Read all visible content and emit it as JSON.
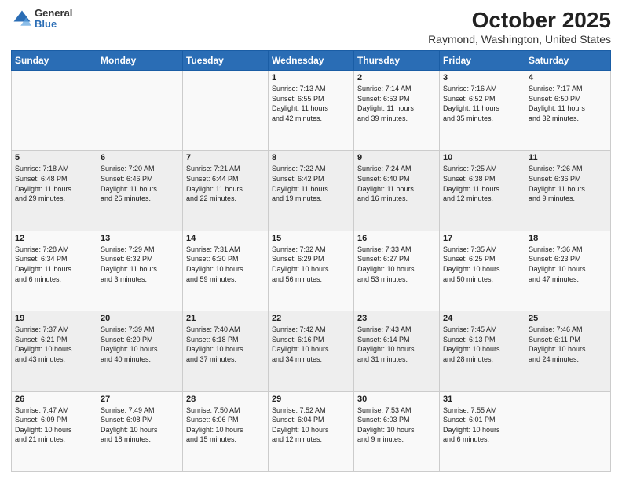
{
  "header": {
    "logo": {
      "general": "General",
      "blue": "Blue"
    },
    "title": "October 2025",
    "subtitle": "Raymond, Washington, United States"
  },
  "weekdays": [
    "Sunday",
    "Monday",
    "Tuesday",
    "Wednesday",
    "Thursday",
    "Friday",
    "Saturday"
  ],
  "weeks": [
    [
      {
        "day": "",
        "info": ""
      },
      {
        "day": "",
        "info": ""
      },
      {
        "day": "",
        "info": ""
      },
      {
        "day": "1",
        "info": "Sunrise: 7:13 AM\nSunset: 6:55 PM\nDaylight: 11 hours\nand 42 minutes."
      },
      {
        "day": "2",
        "info": "Sunrise: 7:14 AM\nSunset: 6:53 PM\nDaylight: 11 hours\nand 39 minutes."
      },
      {
        "day": "3",
        "info": "Sunrise: 7:16 AM\nSunset: 6:52 PM\nDaylight: 11 hours\nand 35 minutes."
      },
      {
        "day": "4",
        "info": "Sunrise: 7:17 AM\nSunset: 6:50 PM\nDaylight: 11 hours\nand 32 minutes."
      }
    ],
    [
      {
        "day": "5",
        "info": "Sunrise: 7:18 AM\nSunset: 6:48 PM\nDaylight: 11 hours\nand 29 minutes."
      },
      {
        "day": "6",
        "info": "Sunrise: 7:20 AM\nSunset: 6:46 PM\nDaylight: 11 hours\nand 26 minutes."
      },
      {
        "day": "7",
        "info": "Sunrise: 7:21 AM\nSunset: 6:44 PM\nDaylight: 11 hours\nand 22 minutes."
      },
      {
        "day": "8",
        "info": "Sunrise: 7:22 AM\nSunset: 6:42 PM\nDaylight: 11 hours\nand 19 minutes."
      },
      {
        "day": "9",
        "info": "Sunrise: 7:24 AM\nSunset: 6:40 PM\nDaylight: 11 hours\nand 16 minutes."
      },
      {
        "day": "10",
        "info": "Sunrise: 7:25 AM\nSunset: 6:38 PM\nDaylight: 11 hours\nand 12 minutes."
      },
      {
        "day": "11",
        "info": "Sunrise: 7:26 AM\nSunset: 6:36 PM\nDaylight: 11 hours\nand 9 minutes."
      }
    ],
    [
      {
        "day": "12",
        "info": "Sunrise: 7:28 AM\nSunset: 6:34 PM\nDaylight: 11 hours\nand 6 minutes."
      },
      {
        "day": "13",
        "info": "Sunrise: 7:29 AM\nSunset: 6:32 PM\nDaylight: 11 hours\nand 3 minutes."
      },
      {
        "day": "14",
        "info": "Sunrise: 7:31 AM\nSunset: 6:30 PM\nDaylight: 10 hours\nand 59 minutes."
      },
      {
        "day": "15",
        "info": "Sunrise: 7:32 AM\nSunset: 6:29 PM\nDaylight: 10 hours\nand 56 minutes."
      },
      {
        "day": "16",
        "info": "Sunrise: 7:33 AM\nSunset: 6:27 PM\nDaylight: 10 hours\nand 53 minutes."
      },
      {
        "day": "17",
        "info": "Sunrise: 7:35 AM\nSunset: 6:25 PM\nDaylight: 10 hours\nand 50 minutes."
      },
      {
        "day": "18",
        "info": "Sunrise: 7:36 AM\nSunset: 6:23 PM\nDaylight: 10 hours\nand 47 minutes."
      }
    ],
    [
      {
        "day": "19",
        "info": "Sunrise: 7:37 AM\nSunset: 6:21 PM\nDaylight: 10 hours\nand 43 minutes."
      },
      {
        "day": "20",
        "info": "Sunrise: 7:39 AM\nSunset: 6:20 PM\nDaylight: 10 hours\nand 40 minutes."
      },
      {
        "day": "21",
        "info": "Sunrise: 7:40 AM\nSunset: 6:18 PM\nDaylight: 10 hours\nand 37 minutes."
      },
      {
        "day": "22",
        "info": "Sunrise: 7:42 AM\nSunset: 6:16 PM\nDaylight: 10 hours\nand 34 minutes."
      },
      {
        "day": "23",
        "info": "Sunrise: 7:43 AM\nSunset: 6:14 PM\nDaylight: 10 hours\nand 31 minutes."
      },
      {
        "day": "24",
        "info": "Sunrise: 7:45 AM\nSunset: 6:13 PM\nDaylight: 10 hours\nand 28 minutes."
      },
      {
        "day": "25",
        "info": "Sunrise: 7:46 AM\nSunset: 6:11 PM\nDaylight: 10 hours\nand 24 minutes."
      }
    ],
    [
      {
        "day": "26",
        "info": "Sunrise: 7:47 AM\nSunset: 6:09 PM\nDaylight: 10 hours\nand 21 minutes."
      },
      {
        "day": "27",
        "info": "Sunrise: 7:49 AM\nSunset: 6:08 PM\nDaylight: 10 hours\nand 18 minutes."
      },
      {
        "day": "28",
        "info": "Sunrise: 7:50 AM\nSunset: 6:06 PM\nDaylight: 10 hours\nand 15 minutes."
      },
      {
        "day": "29",
        "info": "Sunrise: 7:52 AM\nSunset: 6:04 PM\nDaylight: 10 hours\nand 12 minutes."
      },
      {
        "day": "30",
        "info": "Sunrise: 7:53 AM\nSunset: 6:03 PM\nDaylight: 10 hours\nand 9 minutes."
      },
      {
        "day": "31",
        "info": "Sunrise: 7:55 AM\nSunset: 6:01 PM\nDaylight: 10 hours\nand 6 minutes."
      },
      {
        "day": "",
        "info": ""
      }
    ]
  ]
}
